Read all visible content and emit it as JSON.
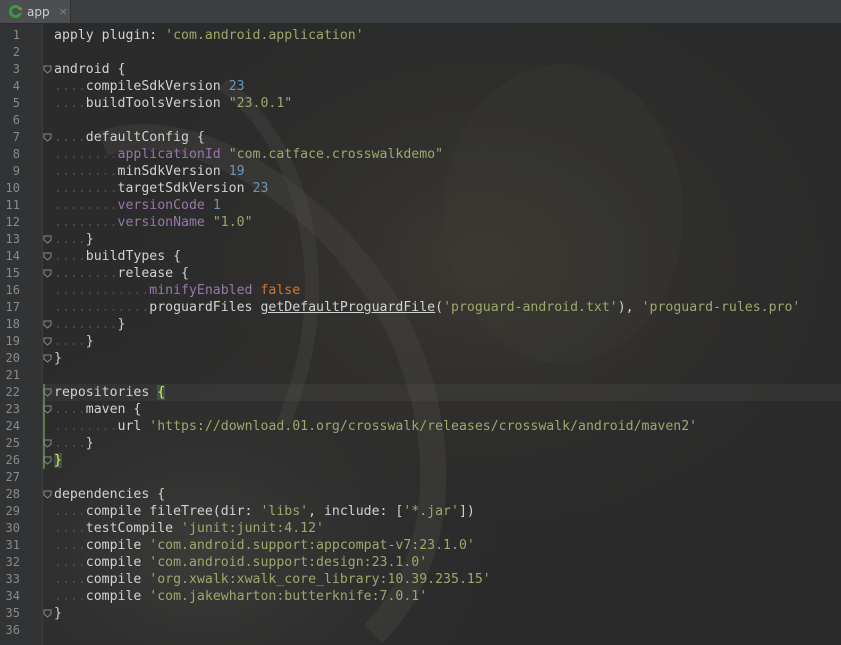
{
  "tab": {
    "label": "app",
    "close_glyph": "×",
    "icon": "gradle-module-icon"
  },
  "editor": {
    "line_count": 36,
    "lines": [
      [
        {
          "t": "apply plugin: ",
          "c": "k"
        },
        {
          "t": "'com.android.application'",
          "c": "str"
        }
      ],
      [],
      [
        {
          "t": "android {",
          "c": "k"
        }
      ],
      [
        {
          "t": "....",
          "c": "dots"
        },
        {
          "t": "compileSdkVersion ",
          "c": "k"
        },
        {
          "t": "23",
          "c": "num"
        }
      ],
      [
        {
          "t": "....",
          "c": "dots"
        },
        {
          "t": "buildToolsVersion ",
          "c": "k"
        },
        {
          "t": "\"23.0.1\"",
          "c": "str"
        }
      ],
      [],
      [
        {
          "t": "....",
          "c": "dots"
        },
        {
          "t": "defaultConfig {",
          "c": "k"
        }
      ],
      [
        {
          "t": "........",
          "c": "dots"
        },
        {
          "t": "applicationId ",
          "c": "prop"
        },
        {
          "t": "\"com.catface.crosswalkdemo\"",
          "c": "str"
        }
      ],
      [
        {
          "t": "........",
          "c": "dots"
        },
        {
          "t": "minSdkVersion ",
          "c": "k"
        },
        {
          "t": "19",
          "c": "num"
        }
      ],
      [
        {
          "t": "........",
          "c": "dots"
        },
        {
          "t": "targetSdkVersion ",
          "c": "k"
        },
        {
          "t": "23",
          "c": "num"
        }
      ],
      [
        {
          "t": "........",
          "c": "dots"
        },
        {
          "t": "versionCode ",
          "c": "prop"
        },
        {
          "t": "1",
          "c": "num"
        }
      ],
      [
        {
          "t": "........",
          "c": "dots"
        },
        {
          "t": "versionName ",
          "c": "prop"
        },
        {
          "t": "\"1.0\"",
          "c": "str"
        }
      ],
      [
        {
          "t": "....",
          "c": "dots"
        },
        {
          "t": "}",
          "c": "k"
        }
      ],
      [
        {
          "t": "....",
          "c": "dots"
        },
        {
          "t": "buildTypes {",
          "c": "k"
        }
      ],
      [
        {
          "t": "........",
          "c": "dots"
        },
        {
          "t": "release {",
          "c": "k"
        }
      ],
      [
        {
          "t": "............",
          "c": "dots"
        },
        {
          "t": "minifyEnabled ",
          "c": "prop"
        },
        {
          "t": "false",
          "c": "kw"
        }
      ],
      [
        {
          "t": "............",
          "c": "dots"
        },
        {
          "t": "proguardFiles ",
          "c": "k"
        },
        {
          "t": "getDefaultProguardFile",
          "c": "meth"
        },
        {
          "t": "(",
          "c": "k"
        },
        {
          "t": "'proguard-android.txt'",
          "c": "str"
        },
        {
          "t": "), ",
          "c": "k"
        },
        {
          "t": "'proguard-rules.pro'",
          "c": "str"
        }
      ],
      [
        {
          "t": "........",
          "c": "dots"
        },
        {
          "t": "}",
          "c": "k"
        }
      ],
      [
        {
          "t": "....",
          "c": "dots"
        },
        {
          "t": "}",
          "c": "k"
        }
      ],
      [
        {
          "t": "}",
          "c": "k"
        }
      ],
      [],
      [
        {
          "t": "repositories ",
          "c": "k"
        },
        {
          "t": "{",
          "c": "brace-hl"
        }
      ],
      [
        {
          "t": "....",
          "c": "dots"
        },
        {
          "t": "maven {",
          "c": "k"
        }
      ],
      [
        {
          "t": "........",
          "c": "dots"
        },
        {
          "t": "url ",
          "c": "k"
        },
        {
          "t": "'https://download.01.org/crosswalk/releases/crosswalk/android/maven2'",
          "c": "str"
        }
      ],
      [
        {
          "t": "....",
          "c": "dots"
        },
        {
          "t": "}",
          "c": "k"
        }
      ],
      [
        {
          "t": "}",
          "c": "brace-hl"
        }
      ],
      [],
      [
        {
          "t": "dependencies {",
          "c": "k"
        }
      ],
      [
        {
          "t": "....",
          "c": "dots"
        },
        {
          "t": "compile fileTree(dir: ",
          "c": "k"
        },
        {
          "t": "'libs'",
          "c": "str"
        },
        {
          "t": ", include: [",
          "c": "k"
        },
        {
          "t": "'*.jar'",
          "c": "str"
        },
        {
          "t": "])",
          "c": "k"
        }
      ],
      [
        {
          "t": "....",
          "c": "dots"
        },
        {
          "t": "testCompile ",
          "c": "k"
        },
        {
          "t": "'junit:junit:4.12'",
          "c": "str"
        }
      ],
      [
        {
          "t": "....",
          "c": "dots"
        },
        {
          "t": "compile ",
          "c": "k"
        },
        {
          "t": "'com.android.support:appcompat-v7:23.1.0'",
          "c": "str"
        }
      ],
      [
        {
          "t": "....",
          "c": "dots"
        },
        {
          "t": "compile ",
          "c": "k"
        },
        {
          "t": "'com.android.support:design:23.1.0'",
          "c": "str"
        }
      ],
      [
        {
          "t": "....",
          "c": "dots"
        },
        {
          "t": "compile ",
          "c": "k"
        },
        {
          "t": "'org.xwalk:xwalk_core_library:10.39.235.15'",
          "c": "str"
        }
      ],
      [
        {
          "t": "....",
          "c": "dots"
        },
        {
          "t": "compile ",
          "c": "k"
        },
        {
          "t": "'com.jakewharton:butterknife:7.0.1'",
          "c": "str"
        }
      ],
      [
        {
          "t": "}",
          "c": "k"
        }
      ],
      []
    ],
    "fold_markers": [
      3,
      7,
      13,
      14,
      15,
      18,
      19,
      20,
      22,
      23,
      25,
      26,
      28,
      35
    ],
    "caret_line": 22,
    "changed_lines": [
      22,
      26
    ],
    "colors": {
      "background": "#2b2b2b",
      "gutter": "#313335",
      "string": "#9ea86b",
      "number": "#6897bb",
      "property": "#9876aa",
      "keyword": "#cc7832",
      "brace_highlight": "#ffef28"
    }
  }
}
